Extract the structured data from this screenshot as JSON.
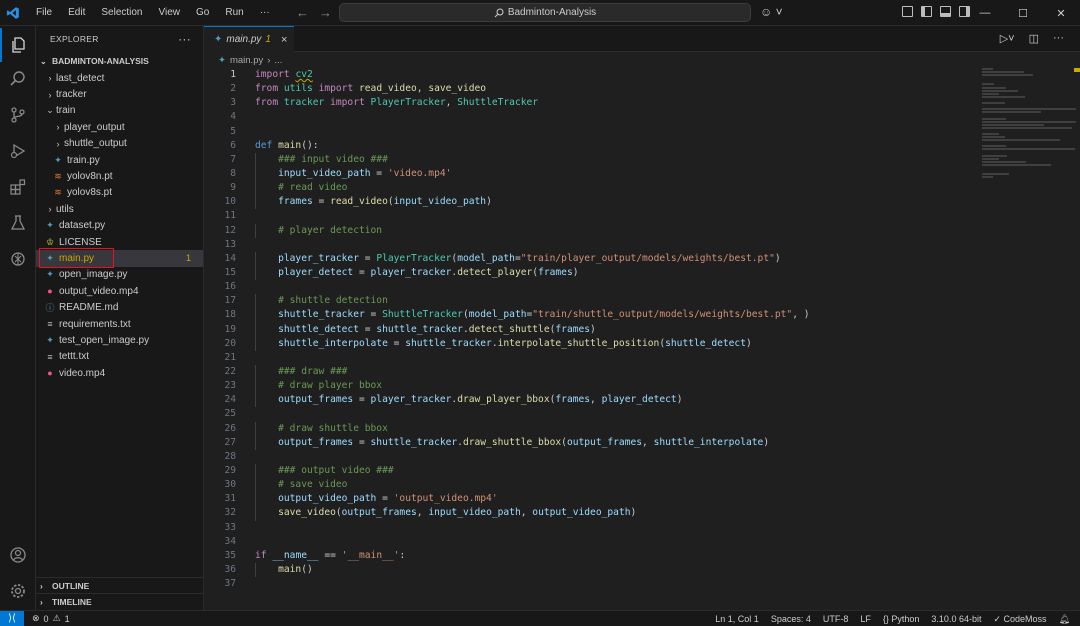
{
  "titlebar": {
    "menus": [
      "File",
      "Edit",
      "Selection",
      "View",
      "Go",
      "Run",
      "···"
    ],
    "search_text": "Badminton-Analysis"
  },
  "sidebar": {
    "title": "EXPLORER",
    "root": "BADMINTON-ANALYSIS",
    "items": [
      {
        "label": "last_detect",
        "type": "folder",
        "depth": 0
      },
      {
        "label": "tracker",
        "type": "folder",
        "depth": 0
      },
      {
        "label": "train",
        "type": "folder-open",
        "depth": 0
      },
      {
        "label": "player_output",
        "type": "folder",
        "depth": 1
      },
      {
        "label": "shuttle_output",
        "type": "folder",
        "depth": 1
      },
      {
        "label": "train.py",
        "type": "python",
        "depth": 1
      },
      {
        "label": "yolov8n.pt",
        "type": "pt",
        "depth": 1
      },
      {
        "label": "yolov8s.pt",
        "type": "pt",
        "depth": 1
      },
      {
        "label": "utils",
        "type": "folder",
        "depth": 0
      },
      {
        "label": "dataset.py",
        "type": "python",
        "depth": 0
      },
      {
        "label": "LICENSE",
        "type": "license",
        "depth": 0
      },
      {
        "label": "main.py",
        "type": "python",
        "depth": 0,
        "selected": true,
        "badge": "1"
      },
      {
        "label": "open_image.py",
        "type": "python",
        "depth": 0
      },
      {
        "label": "output_video.mp4",
        "type": "video",
        "depth": 0
      },
      {
        "label": "README.md",
        "type": "info",
        "depth": 0
      },
      {
        "label": "requirements.txt",
        "type": "text",
        "depth": 0
      },
      {
        "label": "test_open_image.py",
        "type": "python",
        "depth": 0
      },
      {
        "label": "tettt.txt",
        "type": "text",
        "depth": 0
      },
      {
        "label": "video.mp4",
        "type": "video",
        "depth": 0
      }
    ],
    "outline": "OUTLINE",
    "timeline": "TIMELINE"
  },
  "editor": {
    "tab": {
      "name": "main.py",
      "problems": "1",
      "close": "×"
    },
    "breadcrumb": [
      "main.py",
      "..."
    ],
    "current_line": 1,
    "lines": [
      [
        [
          "kw",
          "import"
        ],
        [
          "txt",
          " "
        ],
        [
          "modsq",
          "cv2"
        ]
      ],
      [
        [
          "kw",
          "from"
        ],
        [
          "txt",
          " "
        ],
        [
          "mod",
          "utils"
        ],
        [
          "txt",
          " "
        ],
        [
          "kw",
          "import"
        ],
        [
          "txt",
          " "
        ],
        [
          "fn",
          "read_video"
        ],
        [
          "txt",
          ", "
        ],
        [
          "fn",
          "save_video"
        ]
      ],
      [
        [
          "kw",
          "from"
        ],
        [
          "txt",
          " "
        ],
        [
          "mod",
          "tracker"
        ],
        [
          "txt",
          " "
        ],
        [
          "kw",
          "import"
        ],
        [
          "txt",
          " "
        ],
        [
          "cls",
          "PlayerTracker"
        ],
        [
          "txt",
          ", "
        ],
        [
          "cls",
          "ShuttleTracker"
        ]
      ],
      [],
      [],
      [
        [
          "def",
          "def"
        ],
        [
          "txt",
          " "
        ],
        [
          "fn",
          "main"
        ],
        [
          "txt",
          "():"
        ]
      ],
      [
        [
          "txt",
          "    "
        ],
        [
          "cm",
          "### input video ###"
        ]
      ],
      [
        [
          "txt",
          "    "
        ],
        [
          "var",
          "input_video_path"
        ],
        [
          "txt",
          " = "
        ],
        [
          "str",
          "'video.mp4'"
        ]
      ],
      [
        [
          "txt",
          "    "
        ],
        [
          "cm",
          "# read video"
        ]
      ],
      [
        [
          "txt",
          "    "
        ],
        [
          "var",
          "frames"
        ],
        [
          "txt",
          " = "
        ],
        [
          "fn",
          "read_video"
        ],
        [
          "txt",
          "("
        ],
        [
          "var",
          "input_video_path"
        ],
        [
          "txt",
          ")"
        ]
      ],
      [],
      [
        [
          "txt",
          "    "
        ],
        [
          "cm",
          "# player detection"
        ]
      ],
      [],
      [
        [
          "txt",
          "    "
        ],
        [
          "var",
          "player_tracker"
        ],
        [
          "txt",
          " = "
        ],
        [
          "cls",
          "PlayerTracker"
        ],
        [
          "txt",
          "("
        ],
        [
          "var",
          "model_path"
        ],
        [
          "txt",
          "="
        ],
        [
          "str",
          "\"train/player_output/models/weights/best.pt\""
        ],
        [
          "txt",
          ")"
        ]
      ],
      [
        [
          "txt",
          "    "
        ],
        [
          "var",
          "player_detect"
        ],
        [
          "txt",
          " = "
        ],
        [
          "var",
          "player_tracker"
        ],
        [
          "txt",
          "."
        ],
        [
          "fn",
          "detect_player"
        ],
        [
          "txt",
          "("
        ],
        [
          "var",
          "frames"
        ],
        [
          "txt",
          ")"
        ]
      ],
      [],
      [
        [
          "txt",
          "    "
        ],
        [
          "cm",
          "# shuttle detection"
        ]
      ],
      [
        [
          "txt",
          "    "
        ],
        [
          "var",
          "shuttle_tracker"
        ],
        [
          "txt",
          " = "
        ],
        [
          "cls",
          "ShuttleTracker"
        ],
        [
          "txt",
          "("
        ],
        [
          "var",
          "model_path"
        ],
        [
          "txt",
          "="
        ],
        [
          "str",
          "\"train/shuttle_output/models/weights/best.pt\""
        ],
        [
          "txt",
          ", )"
        ]
      ],
      [
        [
          "txt",
          "    "
        ],
        [
          "var",
          "shuttle_detect"
        ],
        [
          "txt",
          " = "
        ],
        [
          "var",
          "shuttle_tracker"
        ],
        [
          "txt",
          "."
        ],
        [
          "fn",
          "detect_shuttle"
        ],
        [
          "txt",
          "("
        ],
        [
          "var",
          "frames"
        ],
        [
          "txt",
          ")"
        ]
      ],
      [
        [
          "txt",
          "    "
        ],
        [
          "var",
          "shuttle_interpolate"
        ],
        [
          "txt",
          " = "
        ],
        [
          "var",
          "shuttle_tracker"
        ],
        [
          "txt",
          "."
        ],
        [
          "fn",
          "interpolate_shuttle_position"
        ],
        [
          "txt",
          "("
        ],
        [
          "var",
          "shuttle_detect"
        ],
        [
          "txt",
          ")"
        ]
      ],
      [],
      [
        [
          "txt",
          "    "
        ],
        [
          "cm",
          "### draw ###"
        ]
      ],
      [
        [
          "txt",
          "    "
        ],
        [
          "cm",
          "# draw player bbox"
        ]
      ],
      [
        [
          "txt",
          "    "
        ],
        [
          "var",
          "output_frames"
        ],
        [
          "txt",
          " = "
        ],
        [
          "var",
          "player_tracker"
        ],
        [
          "txt",
          "."
        ],
        [
          "fn",
          "draw_player_bbox"
        ],
        [
          "txt",
          "("
        ],
        [
          "var",
          "frames"
        ],
        [
          "txt",
          ", "
        ],
        [
          "var",
          "player_detect"
        ],
        [
          "txt",
          ")"
        ]
      ],
      [],
      [
        [
          "txt",
          "    "
        ],
        [
          "cm",
          "# draw shuttle bbox"
        ]
      ],
      [
        [
          "txt",
          "    "
        ],
        [
          "var",
          "output_frames"
        ],
        [
          "txt",
          " = "
        ],
        [
          "var",
          "shuttle_tracker"
        ],
        [
          "txt",
          "."
        ],
        [
          "fn",
          "draw_shuttle_bbox"
        ],
        [
          "txt",
          "("
        ],
        [
          "var",
          "output_frames"
        ],
        [
          "txt",
          ", "
        ],
        [
          "var",
          "shuttle_interpolate"
        ],
        [
          "txt",
          ")"
        ]
      ],
      [],
      [
        [
          "txt",
          "    "
        ],
        [
          "cm",
          "### output video ###"
        ]
      ],
      [
        [
          "txt",
          "    "
        ],
        [
          "cm",
          "# save video"
        ]
      ],
      [
        [
          "txt",
          "    "
        ],
        [
          "var",
          "output_video_path"
        ],
        [
          "txt",
          " = "
        ],
        [
          "str",
          "'output_video.mp4'"
        ]
      ],
      [
        [
          "txt",
          "    "
        ],
        [
          "fn",
          "save_video"
        ],
        [
          "txt",
          "("
        ],
        [
          "var",
          "output_frames"
        ],
        [
          "txt",
          ", "
        ],
        [
          "var",
          "input_video_path"
        ],
        [
          "txt",
          ", "
        ],
        [
          "var",
          "output_video_path"
        ],
        [
          "txt",
          ")"
        ]
      ],
      [],
      [],
      [
        [
          "kw",
          "if"
        ],
        [
          "txt",
          " "
        ],
        [
          "var",
          "__name__"
        ],
        [
          "txt",
          " == "
        ],
        [
          "str",
          "'__main__'"
        ],
        [
          "txt",
          ":"
        ]
      ],
      [
        [
          "txt",
          "    "
        ],
        [
          "fn",
          "main"
        ],
        [
          "txt",
          "()"
        ]
      ],
      []
    ]
  },
  "statusbar": {
    "errors": "0",
    "warnings": "1",
    "position": "Ln 1, Col 1",
    "spaces": "Spaces: 4",
    "encoding": "UTF-8",
    "eol": "LF",
    "language": "Python",
    "interpreter": "3.10.0 64-bit",
    "extension": "CodeMoss"
  },
  "colors": {
    "accent": "#0078d4",
    "warning": "#cca700",
    "highlight_box": "#e81123"
  }
}
